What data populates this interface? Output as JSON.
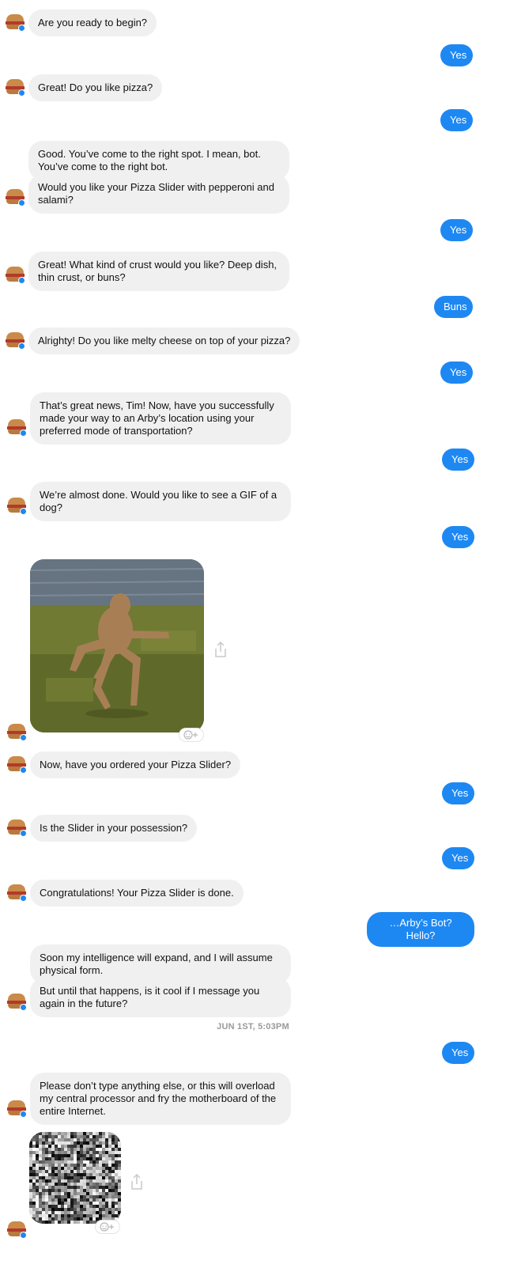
{
  "conversation": {
    "messages": [
      {
        "from": "bot",
        "text": "Are you ready to begin?"
      },
      {
        "from": "user",
        "text": "Yes"
      },
      {
        "from": "bot",
        "text": "Great! Do you like pizza?"
      },
      {
        "from": "user",
        "text": "Yes"
      },
      {
        "from": "bot",
        "text": "Good. You’ve come to the right spot. I mean, bot. You’ve come to the right bot."
      },
      {
        "from": "bot",
        "text": "Would you like your Pizza Slider with pepperoni and salami?"
      },
      {
        "from": "user",
        "text": "Yes"
      },
      {
        "from": "bot",
        "text": "Great! What kind of crust would you like? Deep dish, thin crust, or buns?"
      },
      {
        "from": "user",
        "text": "Buns"
      },
      {
        "from": "bot",
        "text": "Alrighty! Do you like melty cheese on top of your pizza?"
      },
      {
        "from": "user",
        "text": "Yes"
      },
      {
        "from": "bot",
        "text": "That’s great news, Tim! Now, have you successfully made your way to an Arby’s location using your preferred mode of transportation?"
      },
      {
        "from": "user",
        "text": "Yes"
      },
      {
        "from": "bot",
        "text": "We’re almost done. Would you like to see a GIF of a dog?"
      },
      {
        "from": "user",
        "text": "Yes"
      },
      {
        "from": "bot",
        "text": "Now, have you ordered your Pizza Slider?"
      },
      {
        "from": "user",
        "text": "Yes"
      },
      {
        "from": "bot",
        "text": "Is the Slider in your possession?"
      },
      {
        "from": "user",
        "text": "Yes"
      },
      {
        "from": "bot",
        "text": "Congratulations! Your Pizza Slider is done."
      },
      {
        "from": "user",
        "text": "…Arby’s Bot? Hello?"
      },
      {
        "from": "bot",
        "text": "Soon my intelligence will expand, and I will assume physical form."
      },
      {
        "from": "bot",
        "text": "But until that happens, is it cool if I message you again in the future?"
      },
      {
        "from": "user",
        "text": "Yes"
      },
      {
        "from": "bot",
        "text": "Please don’t type anything else, or this will overload my central processor and fry the motherboard of the entire Internet."
      }
    ],
    "timestamp": "JUN 1ST, 5:03PM"
  },
  "attachments": {
    "dog_gif": {
      "type": "gif",
      "icon": "share-icon"
    },
    "static_gif": {
      "type": "gif",
      "icon": "share-icon"
    }
  },
  "theme": {
    "user_bubble": "#1e88f2",
    "bot_bubble": "#f1f0f0",
    "timestamp_color": "#9a9a9a"
  }
}
